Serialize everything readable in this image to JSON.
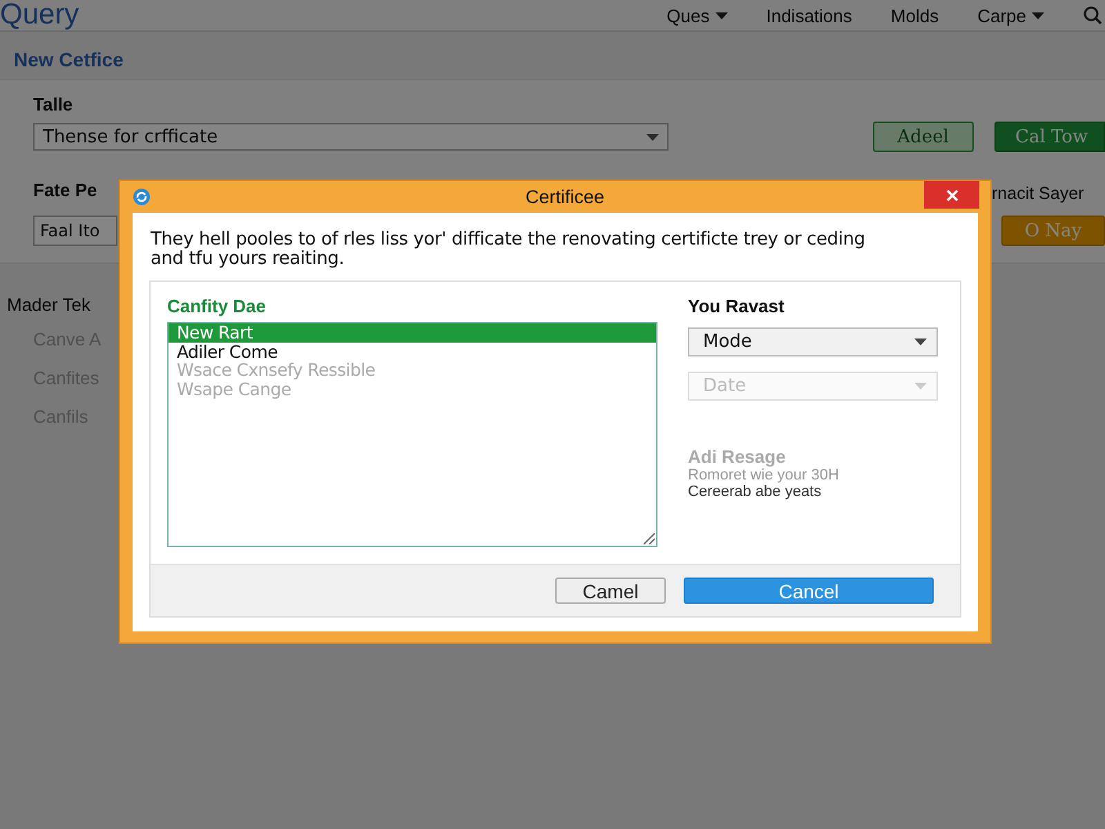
{
  "app": {
    "logo": "Query",
    "nav": [
      {
        "label": "Ques",
        "dropdown": true
      },
      {
        "label": "Indisations",
        "dropdown": false
      },
      {
        "label": "Molds",
        "dropdown": false
      },
      {
        "label": "Carpe",
        "dropdown": true
      }
    ],
    "page_title": "New Cetfice",
    "title_field": {
      "label": "Talle",
      "value": "Thense for crfficate"
    },
    "buttons": [
      {
        "label": "Adeel",
        "kind": "outline"
      },
      {
        "label": "Cal Tow",
        "kind": "primary"
      }
    ],
    "fate_field": {
      "label": "Fate Pe",
      "value": "Faal Ito"
    },
    "side": {
      "label": "rnacit Sayer",
      "button": "O Nay"
    },
    "list": {
      "title": "Mader Tek",
      "items": [
        "Canve A",
        "Canfites",
        "Canfils"
      ]
    }
  },
  "dialog": {
    "title": "Certificee",
    "message": "They hell pooles to of rles liss yor' difficate the renovating certificte trey or ceding and tfu yours reaiting.",
    "list": {
      "title": "Canfity Dae",
      "items": [
        {
          "label": "New Rart",
          "selected": true,
          "disabled": false
        },
        {
          "label": "Adiler Come",
          "selected": false,
          "disabled": false
        },
        {
          "label": "Wsace Cxnsefy Ressible",
          "selected": false,
          "disabled": true
        },
        {
          "label": "Wsape Cange",
          "selected": false,
          "disabled": true
        }
      ]
    },
    "options": {
      "title": "You Ravast",
      "selects": [
        {
          "value": "Mode",
          "disabled": false
        },
        {
          "value": "Date",
          "disabled": true
        }
      ],
      "note_title": "Adi Resage",
      "note_lines": [
        "Romoret wie your 30H",
        "Cereerab abe yeats"
      ]
    },
    "buttons": [
      {
        "label": "Camel",
        "kind": "secondary"
      },
      {
        "label": "Cancel",
        "kind": "primary"
      }
    ]
  }
}
